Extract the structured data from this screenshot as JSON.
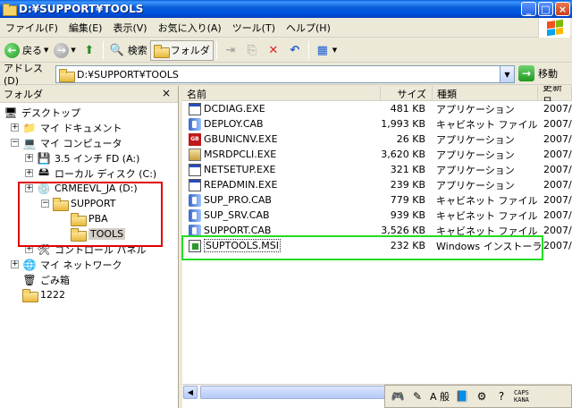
{
  "window": {
    "title": "D:¥SUPPORT¥TOOLS"
  },
  "menu": [
    "ファイル(F)",
    "編集(E)",
    "表示(V)",
    "お気に入り(A)",
    "ツール(T)",
    "ヘルプ(H)"
  ],
  "toolbar": {
    "back_label": "戻る",
    "search_label": "検索",
    "folders_label": "フォルダ"
  },
  "address": {
    "label": "アドレス(D)",
    "value": "D:¥SUPPORT¥TOOLS",
    "go_label": "移動"
  },
  "left_pane": {
    "title": "フォルダ",
    "close_glyph": "×",
    "tree": [
      {
        "label": "デスクトップ",
        "icon": "desktop-icon",
        "glyph": "🖥",
        "expander": ""
      },
      {
        "label": "マイ ドキュメント",
        "icon": "my-documents-icon",
        "glyph": "📁",
        "expander": "+"
      },
      {
        "label": "マイ コンピュータ",
        "icon": "my-computer-icon",
        "glyph": "💻",
        "expander": "−"
      },
      {
        "label": "3.5 インチ FD (A:)",
        "icon": "floppy-icon",
        "glyph": "💾",
        "expander": "+"
      },
      {
        "label": "ローカル ディスク (C:)",
        "icon": "disk-icon",
        "glyph": "🖴",
        "expander": "+"
      },
      {
        "label": "CRMEEVL_JA (D:)",
        "icon": "cdrom-icon",
        "glyph": "💿",
        "expander": "+"
      },
      {
        "label": "SUPPORT",
        "icon": "folder-icon",
        "glyph": "",
        "expander": "−"
      },
      {
        "label": "PBA",
        "icon": "folder-icon",
        "glyph": "",
        "expander": ""
      },
      {
        "label": "TOOLS",
        "icon": "folder-open-icon",
        "glyph": "",
        "expander": ""
      },
      {
        "label": "コントロール パネル",
        "icon": "control-panel-icon",
        "glyph": "🛠",
        "expander": "+"
      },
      {
        "label": "マイ ネットワーク",
        "icon": "network-icon",
        "glyph": "🌐",
        "expander": "+"
      },
      {
        "label": "ごみ箱",
        "icon": "recycle-bin-icon",
        "glyph": "🗑",
        "expander": ""
      },
      {
        "label": "1222",
        "icon": "folder-icon",
        "glyph": "",
        "expander": ""
      }
    ]
  },
  "right_pane": {
    "columns": [
      "名前",
      "サイズ",
      "種類",
      "更新日"
    ],
    "files": [
      {
        "name": "DCDIAG.EXE",
        "size": "481 KB",
        "type": "アプリケーション",
        "date": "2007/",
        "icon": "exe"
      },
      {
        "name": "DEPLOY.CAB",
        "size": "1,993 KB",
        "type": "キャビネット ファイル",
        "date": "2007/",
        "icon": "cab"
      },
      {
        "name": "GBUNICNV.EXE",
        "size": "26 KB",
        "type": "アプリケーション",
        "date": "2007/",
        "icon": "gb"
      },
      {
        "name": "MSRDPCLI.EXE",
        "size": "3,620 KB",
        "type": "アプリケーション",
        "date": "2007/",
        "icon": "msrd"
      },
      {
        "name": "NETSETUP.EXE",
        "size": "321 KB",
        "type": "アプリケーション",
        "date": "2007/",
        "icon": "exe"
      },
      {
        "name": "REPADMIN.EXE",
        "size": "239 KB",
        "type": "アプリケーション",
        "date": "2007/",
        "icon": "exe"
      },
      {
        "name": "SUP_PRO.CAB",
        "size": "779 KB",
        "type": "キャビネット ファイル",
        "date": "2007/",
        "icon": "cab"
      },
      {
        "name": "SUP_SRV.CAB",
        "size": "939 KB",
        "type": "キャビネット ファイル",
        "date": "2007/",
        "icon": "cab"
      },
      {
        "name": "SUPPORT.CAB",
        "size": "3,526 KB",
        "type": "キャビネット ファイル",
        "date": "2007/",
        "icon": "cab"
      },
      {
        "name": "SUPTOOLS.MSI",
        "size": "232 KB",
        "type": "Windows インストーラ...",
        "date": "2007/",
        "icon": "msi"
      }
    ]
  },
  "ime": {
    "mode_label": "A 般",
    "caps_label": "CAPS",
    "kana_label": "KANA"
  },
  "colors": {
    "highlight_red": "#e00000",
    "highlight_green": "#22dd22",
    "title_blue": "#0054e3"
  }
}
